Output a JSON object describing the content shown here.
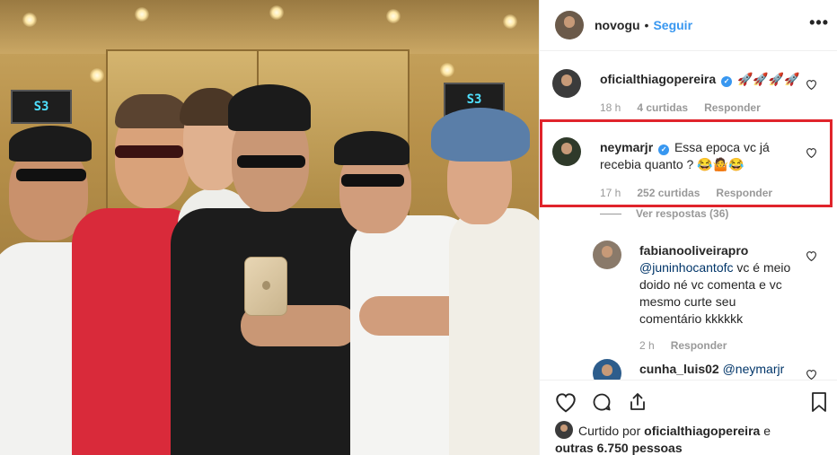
{
  "post": {
    "author": "novogu",
    "follow_label": "Seguir",
    "separator": "•",
    "more_icon": "more-horizontal-icon",
    "elevator_display_left": "S3",
    "elevator_display_right": "S3"
  },
  "comments": [
    {
      "username": "oficialthiagopereira",
      "verified": true,
      "text": "🚀🚀🚀🚀",
      "time": "18 h",
      "likes": "4 curtidas",
      "reply_label": "Responder"
    },
    {
      "username": "neymarjr",
      "verified": true,
      "text": "Essa epoca vc já recebia quanto ? 😂🤷😂",
      "time": "17 h",
      "likes": "252 curtidas",
      "reply_label": "Responder",
      "highlighted": true
    }
  ],
  "view_replies_label": "Ver respostas (36)",
  "replies": [
    {
      "username": "fabianooliveirapro",
      "mention": "@juninhocantofc",
      "text": " vc é meio doido né vc comenta e vc mesmo curte seu comentário kkkkkk",
      "time": "2 h",
      "reply_label": "Responder"
    },
    {
      "username": "cunha_luis02",
      "mention": "@neymarjr",
      "text": ""
    }
  ],
  "liked_by": {
    "prefix": "Curtido por",
    "user": "oficialthiagopereira",
    "connector": "e",
    "others": "outras 6.750 pessoas"
  },
  "colors": {
    "link_blue": "#3897f0",
    "highlight_red": "#e0242b",
    "meta_gray": "#999999"
  }
}
